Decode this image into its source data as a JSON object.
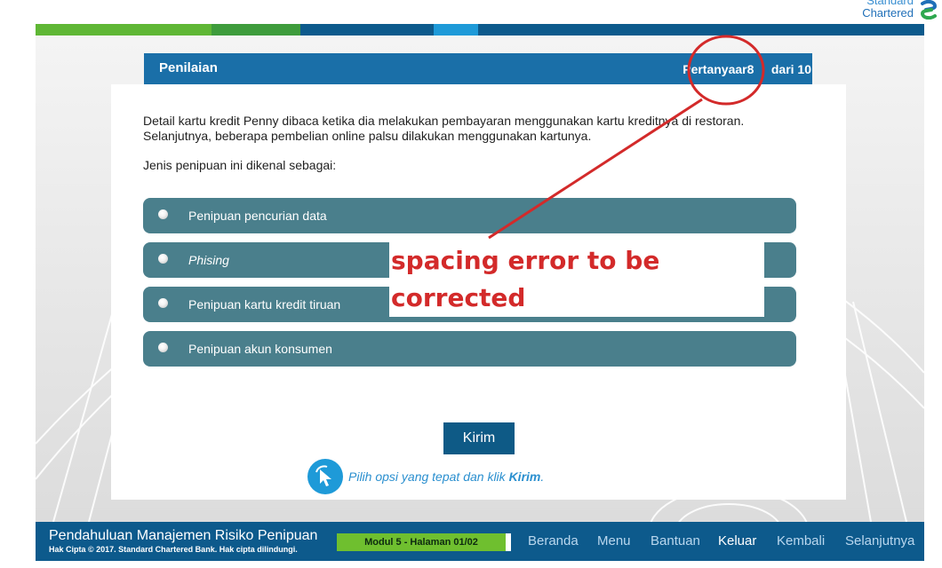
{
  "brand": {
    "line1": "Standard",
    "line2": "Chartered"
  },
  "colors": {
    "header_blue": "#1a6fa8",
    "option_teal": "#4a7f8c",
    "footer_blue": "#0d5a8c",
    "annotation_red": "#d32a2a",
    "module_green": "#6fbf2f"
  },
  "header": {
    "title": "Penilaian",
    "progress_label": "Pertanyaar8",
    "progress_of": "dari 10"
  },
  "question": {
    "text": "Detail kartu kredit Penny dibaca ketika dia melakukan pembayaran menggunakan kartu kreditnya di restoran. Selanjutnya, beberapa pembelian online palsu dilakukan menggunakan kartunya.",
    "prompt": "Jenis penipuan ini dikenal sebagai:"
  },
  "options": [
    {
      "label": "Penipuan pencurian data"
    },
    {
      "label": "Phising"
    },
    {
      "label": "Penipuan kartu kredit tiruan"
    },
    {
      "label": "Penipuan akun konsumen"
    }
  ],
  "annotation": {
    "line1": "spacing error to be",
    "line2": "corrected"
  },
  "submit": {
    "label": "Kirim"
  },
  "hint": {
    "text": "Pilih opsi yang tepat dan klik ",
    "bold": "Kirim",
    "end": "."
  },
  "footer": {
    "course_title": "Pendahuluan Manajemen Risiko Penipuan",
    "copyright": "Hak Cipta © 2017. Standard Chartered Bank. Hak cipta dilindungi.",
    "module": "Modul 5 - Halaman 01/02",
    "nav": {
      "home": "Beranda",
      "menu": "Menu",
      "help": "Bantuan",
      "exit": "Keluar",
      "back": "Kembali",
      "next": "Selanjutnya"
    },
    "active_nav": "Keluar"
  }
}
